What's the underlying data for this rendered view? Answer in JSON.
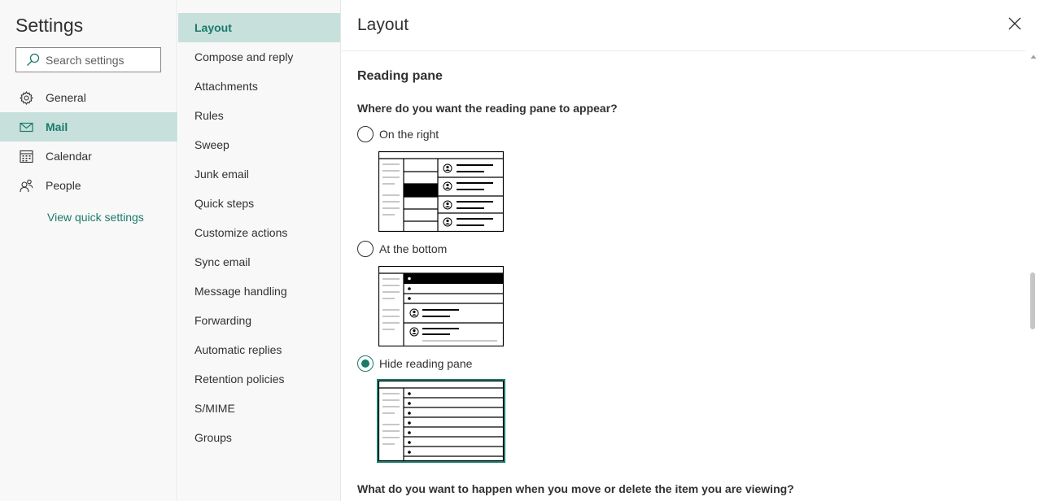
{
  "settings": {
    "title": "Settings",
    "search_placeholder": "Search settings",
    "nav": [
      {
        "label": "General",
        "icon": "gear-icon"
      },
      {
        "label": "Mail",
        "icon": "mail-icon",
        "active": true
      },
      {
        "label": "Calendar",
        "icon": "calendar-icon"
      },
      {
        "label": "People",
        "icon": "people-icon"
      }
    ],
    "quick_settings_link": "View quick settings"
  },
  "categories": [
    {
      "label": "Layout",
      "active": true
    },
    {
      "label": "Compose and reply"
    },
    {
      "label": "Attachments"
    },
    {
      "label": "Rules"
    },
    {
      "label": "Sweep"
    },
    {
      "label": "Junk email"
    },
    {
      "label": "Quick steps"
    },
    {
      "label": "Customize actions"
    },
    {
      "label": "Sync email"
    },
    {
      "label": "Message handling"
    },
    {
      "label": "Forwarding"
    },
    {
      "label": "Automatic replies"
    },
    {
      "label": "Retention policies"
    },
    {
      "label": "S/MIME"
    },
    {
      "label": "Groups"
    }
  ],
  "main": {
    "title": "Layout",
    "section_title": "Reading pane",
    "question": "Where do you want the reading pane to appear?",
    "options": [
      {
        "label": "On the right",
        "checked": false
      },
      {
        "label": "At the bottom",
        "checked": false
      },
      {
        "label": "Hide reading pane",
        "checked": true
      }
    ],
    "question2": "What do you want to happen when you move or delete the item you are viewing?"
  },
  "colors": {
    "accent": "#1a7a6a",
    "active_bg": "#c7e0dc",
    "sidebar_bg": "#f8f8f8"
  }
}
